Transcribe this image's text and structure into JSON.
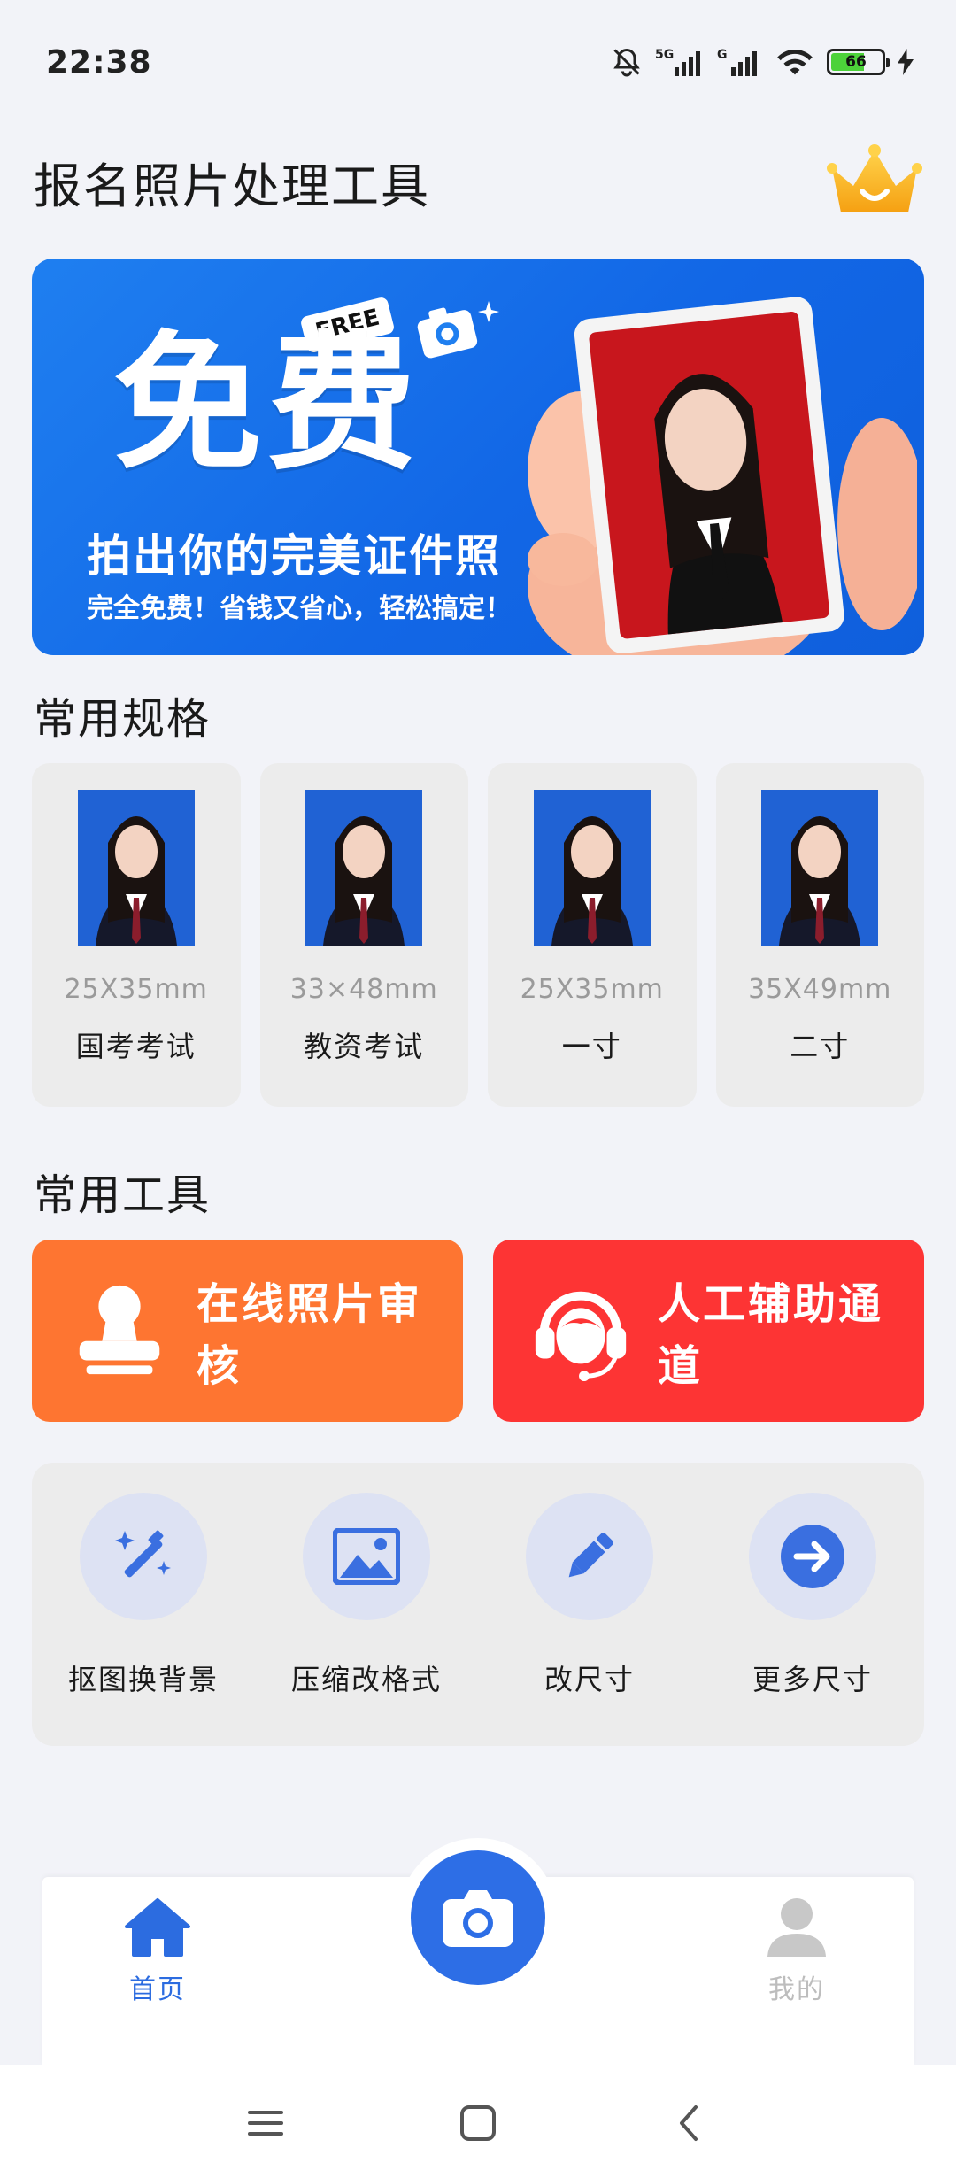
{
  "status_bar": {
    "time": "22:38",
    "battery_level": "66",
    "icons": [
      "bell-off-icon",
      "signal-5g-icon",
      "signal-g-icon",
      "wifi-icon",
      "battery-icon",
      "charging-icon"
    ]
  },
  "header": {
    "title": "报名照片处理工具",
    "vip_icon": "crown-icon"
  },
  "banner": {
    "free_tag": "FREE",
    "headline": "免费",
    "subline": "拍出你的完美证件照",
    "tagline": "完全免费！省钱又省心，轻松搞定！"
  },
  "specs": {
    "title": "常用规格",
    "items": [
      {
        "size": "25X35mm",
        "name": "国考考试"
      },
      {
        "size": "33×48mm",
        "name": "教资考试"
      },
      {
        "size": "25X35mm",
        "name": "一寸"
      },
      {
        "size": "35X49mm",
        "name": "二寸"
      }
    ]
  },
  "tools": {
    "title": "常用工具",
    "primary": [
      {
        "label": "在线照片审核",
        "icon": "stamp-icon",
        "color": "#fe7531"
      },
      {
        "label": "人工辅助通道",
        "icon": "headset-icon",
        "color": "#fd3434"
      }
    ],
    "grid": [
      {
        "label": "抠图换背景",
        "icon": "magic-wand-icon"
      },
      {
        "label": "压缩改格式",
        "icon": "image-icon"
      },
      {
        "label": "改尺寸",
        "icon": "pencil-icon"
      },
      {
        "label": "更多尺寸",
        "icon": "arrow-right-icon"
      }
    ]
  },
  "bottom_nav": {
    "home": "首页",
    "mine": "我的",
    "camera_icon": "camera-icon"
  },
  "colors": {
    "accent": "#2d6ee6",
    "background": "#f2f3f8"
  }
}
